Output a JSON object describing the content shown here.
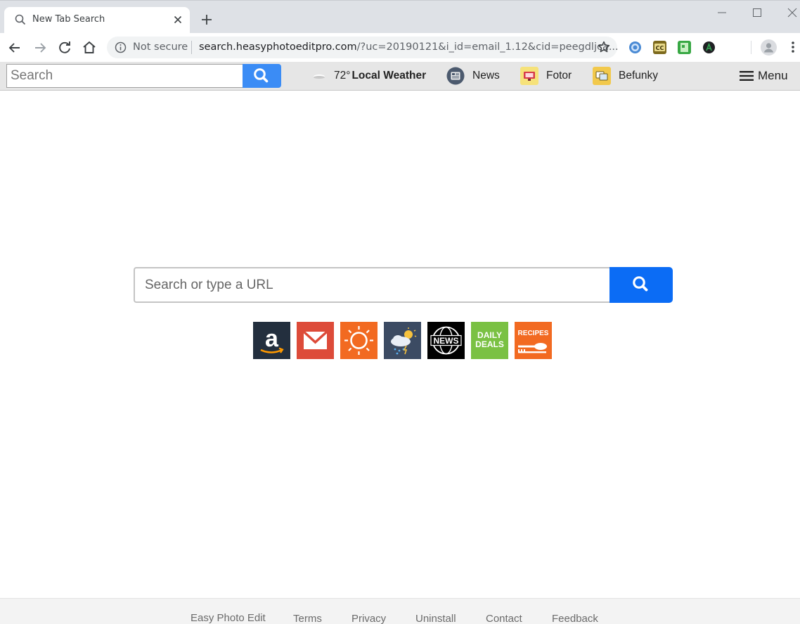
{
  "browser": {
    "tab_title": "New Tab Search",
    "security_label": "Not secure",
    "url_host": "search.heasyphotoeditpro.com",
    "url_rest": "/?uc=20190121&i_id=email_1.12&cid=peegdljca...",
    "extensions": [
      "globe-extension-icon",
      "cc-extension-icon",
      "green-extension-icon",
      "a-extension-icon"
    ]
  },
  "toolbar": {
    "search_placeholder": "Search",
    "weather_temp": "72°",
    "weather_label": "Local Weather",
    "news_label": "News",
    "fotor_label": "Fotor",
    "befunky_label": "Befunky",
    "menu_label": "Menu"
  },
  "main": {
    "search_placeholder": "Search or type a URL",
    "tiles": [
      {
        "name": "amazon",
        "color": "#232f3e"
      },
      {
        "name": "gmail",
        "color": "#dd4b39"
      },
      {
        "name": "weather-sun",
        "color": "#f26a21"
      },
      {
        "name": "weather-storm",
        "color": "#3c4b63"
      },
      {
        "name": "news",
        "color": "#000000",
        "label": "NEWS"
      },
      {
        "name": "daily-deals",
        "color": "#7ac143",
        "label_line1": "DAILY",
        "label_line2": "DEALS"
      },
      {
        "name": "recipes",
        "color": "#f26a21",
        "label": "RECIPES"
      }
    ]
  },
  "footer": {
    "brand": "Easy Photo Edit",
    "terms": "Terms",
    "privacy": "Privacy",
    "uninstall": "Uninstall",
    "contact": "Contact",
    "feedback": "Feedback"
  },
  "colors": {
    "toolbar_btn": "#3b8cf5",
    "main_btn": "#0b6cf5"
  }
}
